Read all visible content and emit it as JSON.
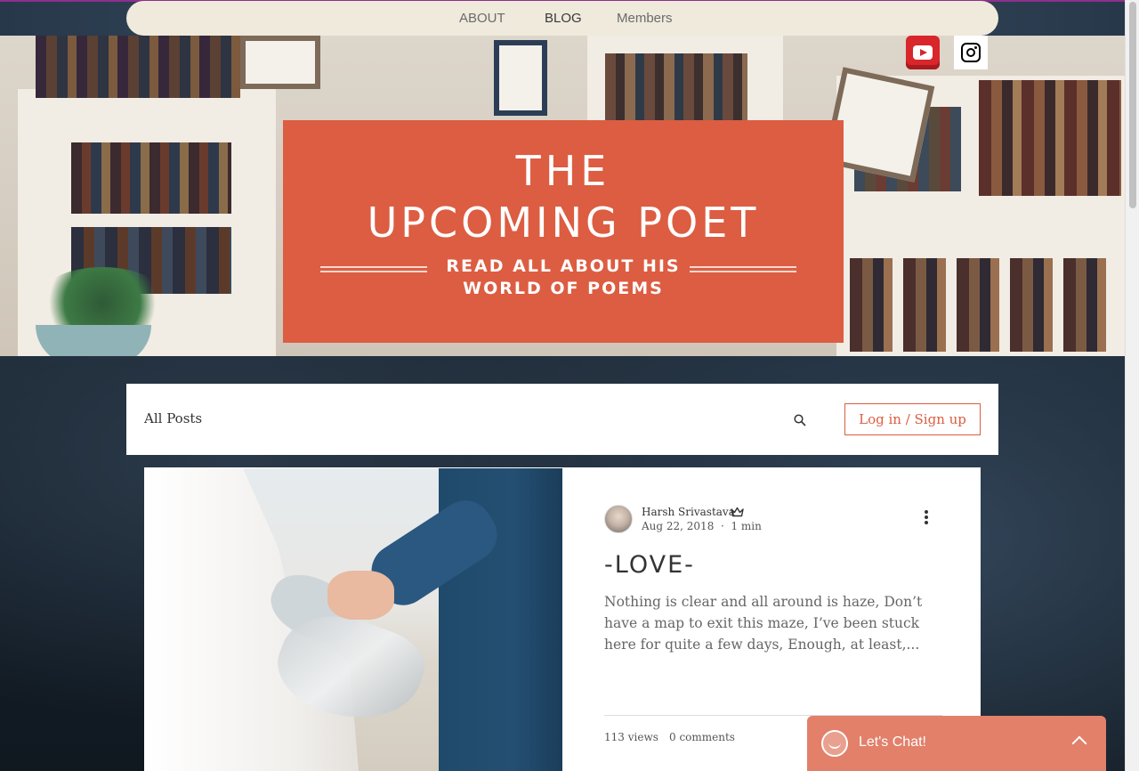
{
  "nav": {
    "items": [
      {
        "label": "ABOUT"
      },
      {
        "label": "BLOG"
      },
      {
        "label": "Members"
      }
    ]
  },
  "header": {
    "title_line1": "THE",
    "title_line2": "UPCOMING POET",
    "subtitle_line1": "READ ALL ABOUT HIS",
    "subtitle_line2": "WORLD OF POEMS",
    "accent_color": "#dc5d42"
  },
  "social": {
    "icons": [
      "youtube-icon",
      "instagram-icon"
    ]
  },
  "blog_bar": {
    "all_posts": "All Posts",
    "login_label": "Log in / Sign up"
  },
  "post": {
    "author": "Harsh Srivastava",
    "date": "Aug 22, 2018",
    "separator": "·",
    "read_time": "1 min",
    "title": "-LOVE-",
    "excerpt": "Nothing is clear and all around is haze, Don’t have a map to exit this maze, I’ve been stuck here for quite a few days, Enough, at least,...",
    "views": "113 views",
    "comments": "0 comments"
  },
  "chat": {
    "label": "Let's Chat!",
    "color": "#e2806a"
  }
}
